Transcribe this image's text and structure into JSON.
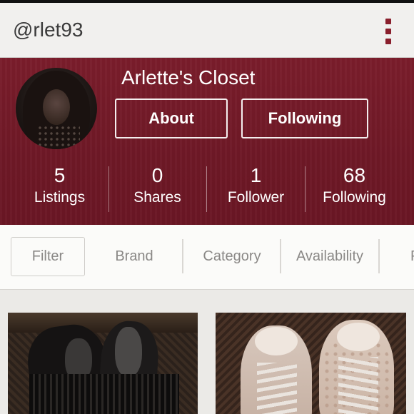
{
  "header": {
    "username": "@rlet93",
    "menu_icon": "overflow-menu-icon",
    "accent_color": "#8a1f2c"
  },
  "profile": {
    "closet_name": "Arlette's Closet",
    "about_label": "About",
    "following_button_label": "Following",
    "background_color": "#6e1826",
    "stats": [
      {
        "value": "5",
        "label": "Listings"
      },
      {
        "value": "0",
        "label": "Shares"
      },
      {
        "value": "1",
        "label": "Follower"
      },
      {
        "value": "68",
        "label": "Following"
      }
    ]
  },
  "filters": {
    "filter_label": "Filter",
    "tabs": [
      "Brand",
      "Category",
      "Availability",
      "P"
    ]
  }
}
